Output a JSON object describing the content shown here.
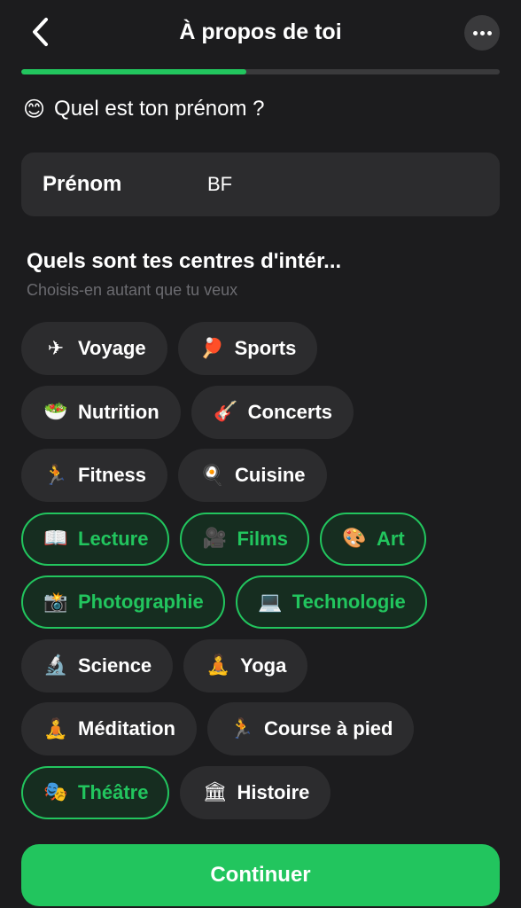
{
  "header": {
    "title": "À propos de toi",
    "back_icon": "chevron-left-icon",
    "more_icon": "ellipsis-icon"
  },
  "progress": {
    "fraction": 0.47,
    "color": "#22c55e"
  },
  "question": {
    "emoji": "😊",
    "text": "Quel est ton prénom ?"
  },
  "name_field": {
    "label": "Prénom",
    "value": "BF"
  },
  "interests": {
    "title": "Quels sont tes centres d'intér...",
    "subtitle": "Choisis-en autant que tu veux",
    "rows": [
      [
        {
          "icon": "✈",
          "icon_name": "airplane-icon",
          "label": "Voyage",
          "selected": false
        },
        {
          "icon": "🏓",
          "icon_name": "ping-pong-icon",
          "label": "Sports",
          "selected": false
        }
      ],
      [
        {
          "icon": "🥗",
          "icon_name": "salad-icon",
          "label": "Nutrition",
          "selected": false
        },
        {
          "icon": "🎸",
          "icon_name": "guitar-icon",
          "label": "Concerts",
          "selected": false
        }
      ],
      [
        {
          "icon": "🏃",
          "icon_name": "runner-icon",
          "label": "Fitness",
          "selected": false
        },
        {
          "icon": "🍳",
          "icon_name": "frying-pan-icon",
          "label": "Cuisine",
          "selected": false
        }
      ],
      [
        {
          "icon": "📖",
          "icon_name": "book-icon",
          "label": "Lecture",
          "selected": true
        },
        {
          "icon": "🎥",
          "icon_name": "movie-camera-icon",
          "label": "Films",
          "selected": true
        },
        {
          "icon": "🎨",
          "icon_name": "palette-icon",
          "label": "Art",
          "selected": true
        }
      ],
      [
        {
          "icon": "📸",
          "icon_name": "camera-flash-icon",
          "label": "Photographie",
          "selected": true
        },
        {
          "icon": "💻",
          "icon_name": "laptop-icon",
          "label": "Technologie",
          "selected": true
        }
      ],
      [
        {
          "icon": "🔬",
          "icon_name": "microscope-icon",
          "label": "Science",
          "selected": false
        },
        {
          "icon": "🧘",
          "icon_name": "yoga-pose-icon",
          "label": "Yoga",
          "selected": false
        }
      ],
      [
        {
          "icon": "🧘",
          "icon_name": "meditation-icon",
          "label": "Méditation",
          "selected": false
        },
        {
          "icon": "🏃",
          "icon_name": "running-icon",
          "label": "Course à pied",
          "selected": false
        }
      ],
      [
        {
          "icon": "🎭",
          "icon_name": "theater-masks-icon",
          "label": "Théâtre",
          "selected": true
        },
        {
          "icon": "🏛",
          "icon_name": "classical-building-icon",
          "label": "Histoire",
          "selected": false
        }
      ]
    ]
  },
  "footer": {
    "continue_label": "Continuer"
  },
  "colors": {
    "background": "#1c1c1e",
    "surface": "#2c2c2e",
    "accent": "#22c55e",
    "muted_text": "#6b6b70"
  }
}
